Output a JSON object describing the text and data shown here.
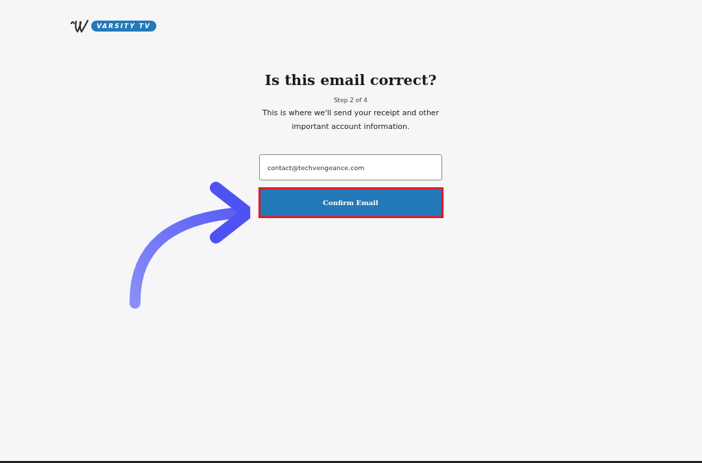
{
  "logo": {
    "text": "VARSITY TV"
  },
  "heading": "Is this email correct?",
  "step": "Step 2 of 4",
  "description": "This is where we'll send your receipt and other important account information.",
  "email_field": {
    "value": "contact@techvengeance.com"
  },
  "confirm_button": {
    "label": "Confirm Email",
    "highlighted": true
  }
}
